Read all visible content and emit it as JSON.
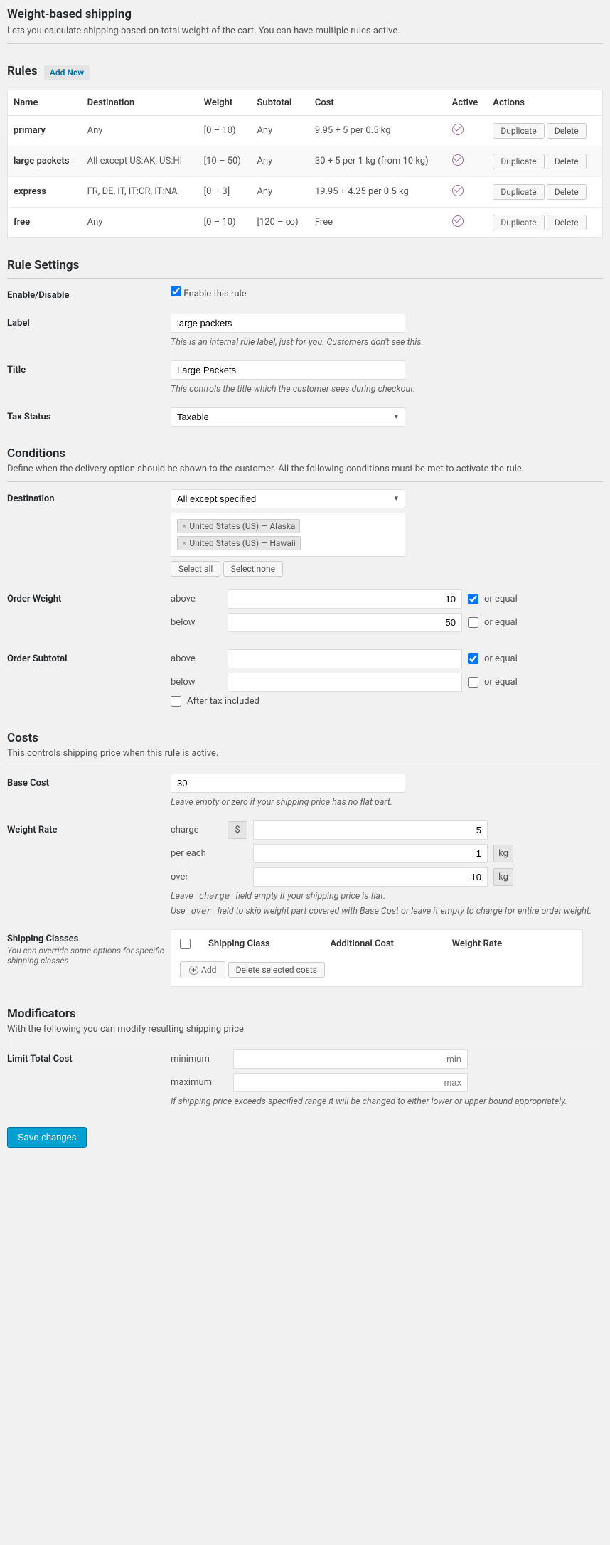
{
  "header": {
    "title": "Weight-based shipping",
    "desc": "Lets you calculate shipping based on total weight of the cart. You can have multiple rules active."
  },
  "rulesSection": {
    "title": "Rules",
    "addNew": "Add New",
    "cols": {
      "name": "Name",
      "dest": "Destination",
      "weight": "Weight",
      "subtotal": "Subtotal",
      "cost": "Cost",
      "active": "Active",
      "actions": "Actions"
    },
    "duplicate": "Duplicate",
    "delete": "Delete",
    "rows": [
      {
        "name": "primary",
        "dest": "Any",
        "weight": "[0 – 10)",
        "subtotal": "Any",
        "cost": "9.95 + 5 per 0.5 kg"
      },
      {
        "name": "large packets",
        "dest": "All except US:AK, US:HI",
        "weight": "[10 – 50)",
        "subtotal": "Any",
        "cost": "30 + 5 per 1 kg (from 10 kg)"
      },
      {
        "name": "express",
        "dest": "FR, DE, IT, IT:CR, IT:NA",
        "weight": "[0 – 3]",
        "subtotal": "Any",
        "cost": "19.95 + 4.25 per 0.5 kg"
      },
      {
        "name": "free",
        "dest": "Any",
        "weight": "[0 – 10)",
        "subtotal": "[120 – ∞)",
        "cost": "Free"
      }
    ]
  },
  "ruleSettings": {
    "title": "Rule Settings",
    "enableLabel": "Enable/Disable",
    "enableText": "Enable this rule",
    "labelLabel": "Label",
    "labelValue": "large packets",
    "labelHelp": "This is an internal rule label, just for you. Customers don't see this.",
    "titleLabel": "Title",
    "titleValue": "Large Packets",
    "titleHelp": "This controls the title which the customer sees during checkout.",
    "taxLabel": "Tax Status",
    "taxValue": "Taxable"
  },
  "conditions": {
    "title": "Conditions",
    "desc": "Define when the delivery option should be shown to the customer. All the following conditions must be met to activate the rule.",
    "destLabel": "Destination",
    "destMode": "All except specified",
    "tags": [
      "United States (US) — Alaska",
      "United States (US) — Hawaii"
    ],
    "selectAll": "Select all",
    "selectNone": "Select none",
    "weightLabel": "Order Weight",
    "subtotalLabel": "Order Subtotal",
    "above": "above",
    "below": "below",
    "orEqual": "or equal",
    "weightAbove": "10",
    "weightBelow": "50",
    "afterTax": "After tax included"
  },
  "costs": {
    "title": "Costs",
    "desc": "This controls shipping price when this rule is active.",
    "baseCostLabel": "Base Cost",
    "baseCostValue": "30",
    "baseCostHelp": "Leave empty or zero if your shipping price has no flat part.",
    "weightRateLabel": "Weight Rate",
    "charge": "charge",
    "chargeValue": "5",
    "perEach": "per each",
    "perEachValue": "1",
    "over": "over",
    "overValue": "10",
    "currency": "$",
    "kg": "kg",
    "weightRateHelp1a": "Leave ",
    "weightRateHelp1b": "charge",
    "weightRateHelp1c": " field empty if your shipping price is flat.",
    "weightRateHelp2a": "Use ",
    "weightRateHelp2b": "over",
    "weightRateHelp2c": " field to skip weight part covered with Base Cost or leave it empty to charge for entire order weight.",
    "scLabel": "Shipping Classes",
    "scSub": "You can override some options for specific shipping classes",
    "scCol1": "Shipping Class",
    "scCol2": "Additional Cost",
    "scCol3": "Weight Rate",
    "addBtn": "Add",
    "deleteSelected": "Delete selected costs"
  },
  "modificators": {
    "title": "Modificators",
    "desc": "With the following you can modify resulting shipping price",
    "limitLabel": "Limit Total Cost",
    "min": "minimum",
    "max": "maximum",
    "minPh": "min",
    "maxPh": "max",
    "help": "If shipping price exceeds specified range it will be changed to either lower or upper bound appropriately."
  },
  "save": "Save changes"
}
